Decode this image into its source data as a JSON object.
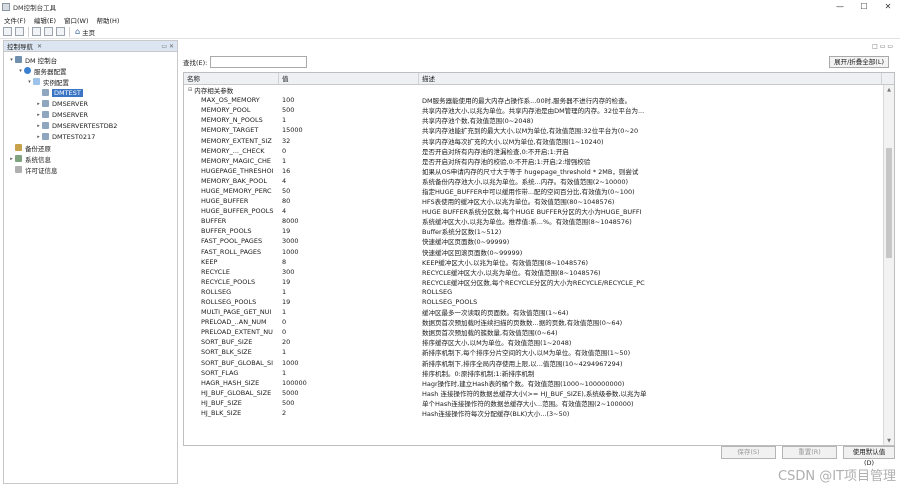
{
  "window": {
    "title": "DM控制台工具",
    "controls": [
      "—",
      "☐",
      "✕"
    ]
  },
  "menubar": [
    "文件(F)",
    "编辑(E)",
    "窗口(W)",
    "帮助(H)"
  ],
  "toolbar": {
    "home_label": "主页"
  },
  "left_panel": {
    "tab_label": "控制导航",
    "tab_close": "✕",
    "tab_ctrl": "▭ ✕"
  },
  "tree": [
    {
      "id": "root",
      "label": "DM 控制台",
      "level": 0,
      "expand": "▾",
      "icon": "root"
    },
    {
      "id": "server-config",
      "label": "服务器配置",
      "level": 1,
      "expand": "▾",
      "icon": "srv"
    },
    {
      "id": "instance-config",
      "label": "实例配置",
      "level": 2,
      "expand": "▾",
      "icon": "cfg"
    },
    {
      "id": "dmtest",
      "label": "DMTEST",
      "level": 3,
      "expand": "",
      "icon": "db",
      "selected": true
    },
    {
      "id": "dmserver",
      "label": "DMSERVER",
      "level": 3,
      "expand": "▸",
      "icon": "db"
    },
    {
      "id": "dmserver2",
      "label": "DMSERVER",
      "level": 3,
      "expand": "▸",
      "icon": "db"
    },
    {
      "id": "dmservertestdb2",
      "label": "DMSERVERTESTDB2",
      "level": 3,
      "expand": "▸",
      "icon": "db"
    },
    {
      "id": "dmtest0217",
      "label": "DMTEST0217",
      "level": 3,
      "expand": "▸",
      "icon": "db"
    },
    {
      "id": "backup",
      "label": "备份还原",
      "level": 0,
      "expand": "",
      "icon": "bk"
    },
    {
      "id": "sysinfo",
      "label": "系统信息",
      "level": 0,
      "expand": "▸",
      "icon": "sys"
    },
    {
      "id": "license",
      "label": "许可证信息",
      "level": 0,
      "expand": "",
      "icon": "lic"
    }
  ],
  "main": {
    "strip_ctrl": "□ ▭ ▭",
    "search_label": "查找(E):",
    "search_value": "",
    "expand_button": "展开/折叠全部(L)"
  },
  "grid": {
    "headers": [
      "名称",
      "值",
      "描述"
    ],
    "group_label": "内存相关参数",
    "rows": [
      [
        "MAX_OS_MEMORY",
        "100",
        "DM服务器能使用的最大内存占操作系...00时,服务器不进行内存的检查。"
      ],
      [
        "MEMORY_POOL",
        "500",
        "共享内存池大小,以兆为单位。共享内存池是由DM管理的内存。32位平台为..."
      ],
      [
        "MEMORY_N_POOLS",
        "1",
        "共享内存池个数,有效值范围(0~2048)"
      ],
      [
        "MEMORY_TARGET",
        "15000",
        "共享内存池能扩充到的最大大小,以M为单位,有效值范围:32位平台为(0~20"
      ],
      [
        "MEMORY_EXTENT_SIZ",
        "32",
        "共享内存池每次扩充的大小,以M为单位,有效值范围(1~10240)"
      ],
      [
        "MEMORY_..._CHECK",
        "0",
        "是否开启对所有内存池的泄漏检查,0:不开启;1:开启"
      ],
      [
        "MEMORY_MAGIC_CHE",
        "1",
        "是否开启对所有内存池的校验,0:不开启;1:开启;2:增强校验"
      ],
      [
        "HUGEPAGE_THRESHOI",
        "16",
        "如果从OS申请内存的尺寸大于等于 hugepage_threshold * 2MB，则尝试"
      ],
      [
        "MEMORY_BAK_POOL",
        "4",
        "系统备份内存池大小,以兆为单位。系统...内存。有效值范围(2~10000)"
      ],
      [
        "HUGE_MEMORY_PERC",
        "50",
        "指定HUGE_BUFFER中可以缓用作带...配的空间百分比,有效值为(0~100)"
      ],
      [
        "HUGE_BUFFER",
        "80",
        "HFS表使用的缓冲区大小,以兆为单位。有效值范围(80~1048576)"
      ],
      [
        "HUGE_BUFFER_POOLS",
        "4",
        "HUGE BUFFER系统分区数,每个HUGE BUFFER分区的大小为HUGE_BUFFI"
      ],
      [
        "BUFFER",
        "8000",
        "系统缓冲区大小,以兆为单位。推荐值:系...%。有效值范围(8~1048576)"
      ],
      [
        "BUFFER_POOLS",
        "19",
        "Buffer系统分区数(1~512)"
      ],
      [
        "FAST_POOL_PAGES",
        "3000",
        "快速缓冲区页面数(0~99999)"
      ],
      [
        "FAST_ROLL_PAGES",
        "1000",
        "快速缓冲区回滚页面数(0~99999)"
      ],
      [
        "KEEP",
        "8",
        "KEEP缓冲区大小,以兆为单位。有效值范围(8~1048576)"
      ],
      [
        "RECYCLE",
        "300",
        "RECYCLE缓冲区大小,以兆为单位。有效值范围(8~1048576)"
      ],
      [
        "RECYCLE_POOLS",
        "19",
        "RECYCLE缓冲区分区数,每个RECYCLE分区的大小为RECYCLE/RECYCLE_PC"
      ],
      [
        "ROLLSEG",
        "1",
        "ROLLSEG"
      ],
      [
        "ROLLSEG_POOLS",
        "19",
        "ROLLSEG_POOLS"
      ],
      [
        "MULTI_PAGE_GET_NUI",
        "1",
        "缓冲区最多一次读取的页面数。有效值范围(1~64)"
      ],
      [
        "PRELOAD_..AN_NUM",
        "0",
        "数据页首次预加载时连续扫描的页数数...据的页数,有效值范围(0~64)"
      ],
      [
        "PRELOAD_EXTENT_NU",
        "0",
        "数据页首次预加载的簇数量,有效值范围(0~64)"
      ],
      [
        "SORT_BUF_SIZE",
        "20",
        "排序缓存区大小,以M为单位。有效值范围(1~2048)"
      ],
      [
        "SORT_BLK_SIZE",
        "1",
        "新排序机制下,每个排序分片空间的大小,以M为单位。有效值范围(1~50)"
      ],
      [
        "SORT_BUF_GLOBAL_SI",
        "1000",
        "新排序机制下,排序全局内存使用上限,以...值范围(10~4294967294)"
      ],
      [
        "SORT_FLAG",
        "1",
        "排序机制。0:原排序机制;1:新排序机制"
      ],
      [
        "HAGR_HASH_SIZE",
        "100000",
        "Hagr操作时,建立Hash表的桶个数。有效值范围(1000~100000000)"
      ],
      [
        "HJ_BUF_GLOBAL_SIZE",
        "5000",
        "Hash 连接操作符的数据总缓存大小(>= HJ_BUF_SIZE),系统级参数,以兆为单"
      ],
      [
        "HJ_BUF_SIZE",
        "500",
        "单个Hash连接操作符的数据总缓存大小...范围。有效值范围(2~100000)"
      ],
      [
        "HJ_BLK_SIZE",
        "2",
        "Hash连接操作符每次分配缓存(BLK)大小...(3~50)"
      ]
    ]
  },
  "bottom_buttons": {
    "save": "保存(S)",
    "reset": "重置(R)",
    "default": "使用默认值(D)"
  },
  "watermark": "CSDN @IT项目管理"
}
